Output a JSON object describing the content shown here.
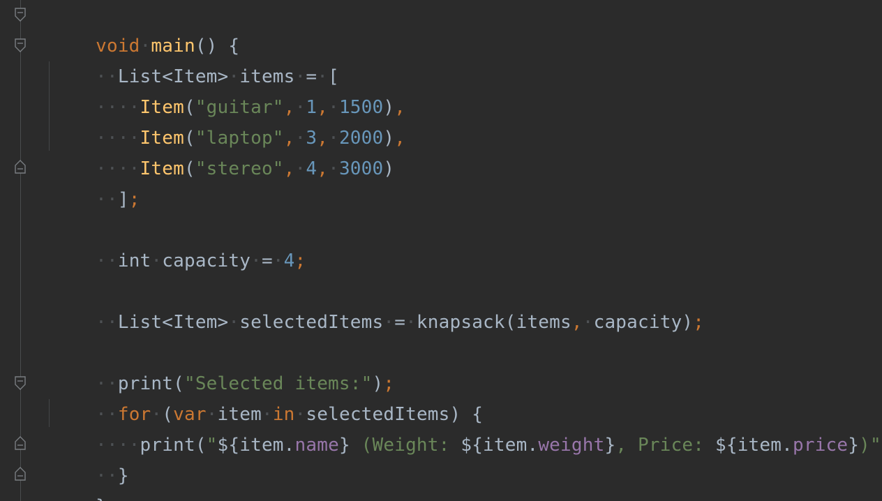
{
  "colors": {
    "background": "#2b2b2b",
    "keyword": "#cc7832",
    "function": "#ffc66d",
    "string": "#6a8759",
    "number": "#6897bb",
    "property": "#9876aa",
    "plain": "#a9b7c6"
  },
  "code": {
    "l1": {
      "kw": "void",
      "name": "main",
      "rest": "() {"
    },
    "l2": {
      "type": "List<Item>",
      "name": "items",
      "op": "=",
      "open": "["
    },
    "l3": {
      "cls": "Item",
      "p1": "(",
      "s": "\"guitar\"",
      "c1": ",",
      "n1": "1",
      "c2": ",",
      "n2": "1500",
      "p2": ")",
      "c3": ","
    },
    "l4": {
      "cls": "Item",
      "p1": "(",
      "s": "\"laptop\"",
      "c1": ",",
      "n1": "3",
      "c2": ",",
      "n2": "2000",
      "p2": ")",
      "c3": ","
    },
    "l5": {
      "cls": "Item",
      "p1": "(",
      "s": "\"stereo\"",
      "c1": ",",
      "n1": "4",
      "c2": ",",
      "n2": "3000",
      "p2": ")"
    },
    "l6": {
      "close": "]",
      "semi": ";"
    },
    "l7": {
      "type": "int",
      "name": "capacity",
      "op": "=",
      "n": "4",
      "semi": ";"
    },
    "l8": {
      "type": "List<Item>",
      "name": "selectedItems",
      "op": "=",
      "call": "knapsack(items",
      "comma": ",",
      "arg": "capacity)",
      "semi": ";"
    },
    "l9": {
      "call": "print(",
      "s": "\"Selected items:\"",
      "close": ")",
      "semi": ";"
    },
    "l10": {
      "kw": "for",
      "open": "(",
      "kw2": "var",
      "v": "item",
      "kw3": "in",
      "rest": "selectedItems) {"
    },
    "l11": {
      "call": "print(",
      "q1": "\"",
      "i1a": "${item.",
      "i1b": "name",
      "i1c": "}",
      "t1": " (Weight: ",
      "i2a": "${item.",
      "i2b": "weight",
      "i2c": "}",
      "t2": ", Price: ",
      "i3a": "${item.",
      "i3b": "price",
      "i3c": "}",
      "t3": ")\"",
      "close": ")",
      "semi": ";"
    },
    "l12": {
      "close": "}"
    },
    "l13": {
      "close": "}"
    }
  }
}
